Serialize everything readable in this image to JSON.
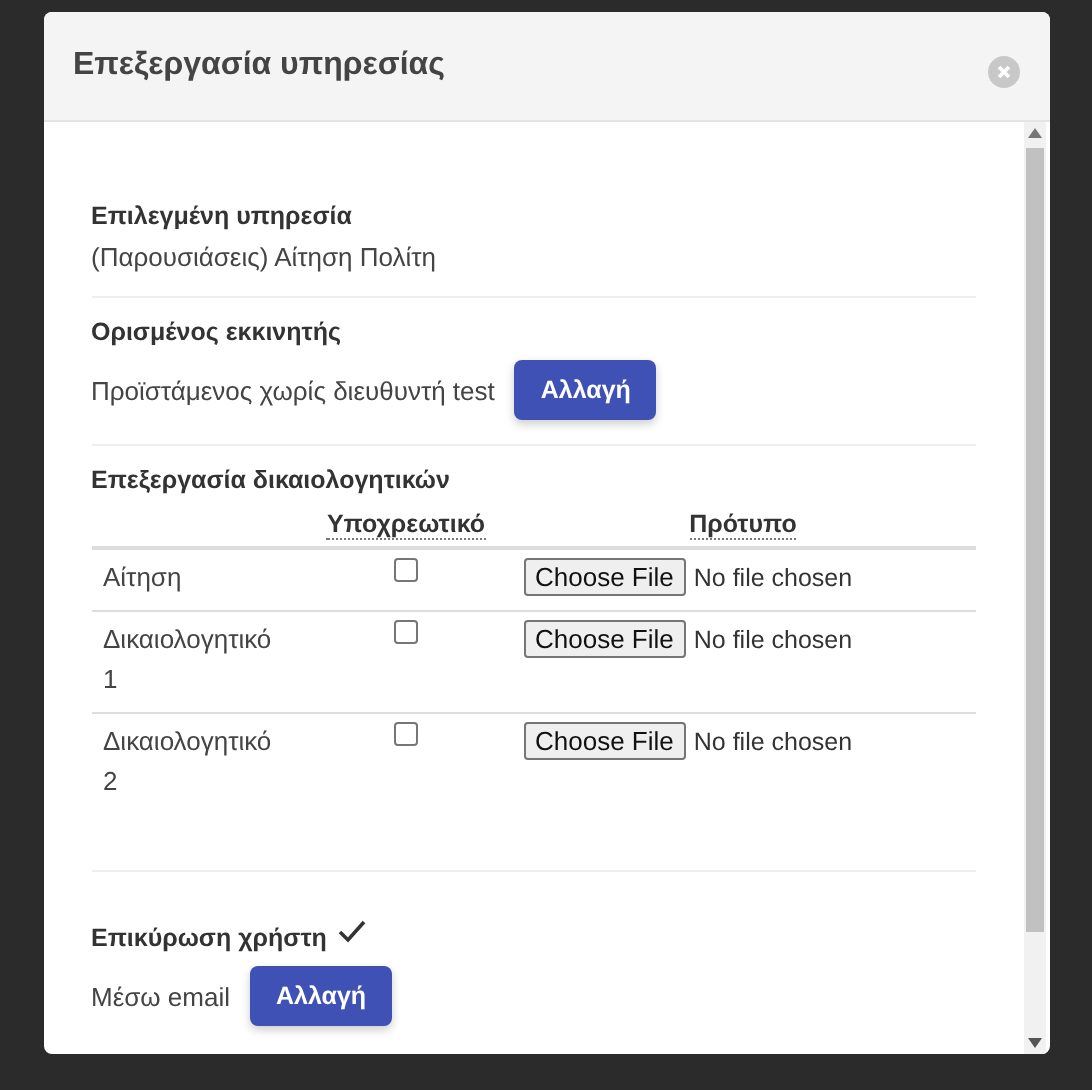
{
  "dialog": {
    "title": "Επεξεργασία υπηρεσίας",
    "selected_service": {
      "label": "Επιλεγμένη υπηρεσία",
      "value": "(Παρουσιάσεις) Αίτηση Πολίτη"
    },
    "initiator": {
      "label": "Ορισμένος εκκινητής",
      "value": "Προϊστάμενος χωρίς διευθυντή test",
      "button": "Αλλαγή"
    },
    "documents": {
      "label": "Επεξεργασία δικαιολογητικών",
      "columns": [
        "Υποχρεωτικό",
        "Πρότυπο"
      ],
      "rows": [
        {
          "name": "Αίτηση",
          "checked": false,
          "file_button": "Choose File",
          "file_status": "No file chosen"
        },
        {
          "name": "Δικαιολογητικό 1",
          "checked": false,
          "file_button": "Choose File",
          "file_status": "No file chosen"
        },
        {
          "name": "Δικαιολογητικό 2",
          "checked": false,
          "file_button": "Choose File",
          "file_status": "No file chosen"
        }
      ]
    },
    "verification": {
      "label": "Επικύρωση χρήστη",
      "verified": true,
      "value": "Μέσω email",
      "button": "Αλλαγή"
    }
  }
}
